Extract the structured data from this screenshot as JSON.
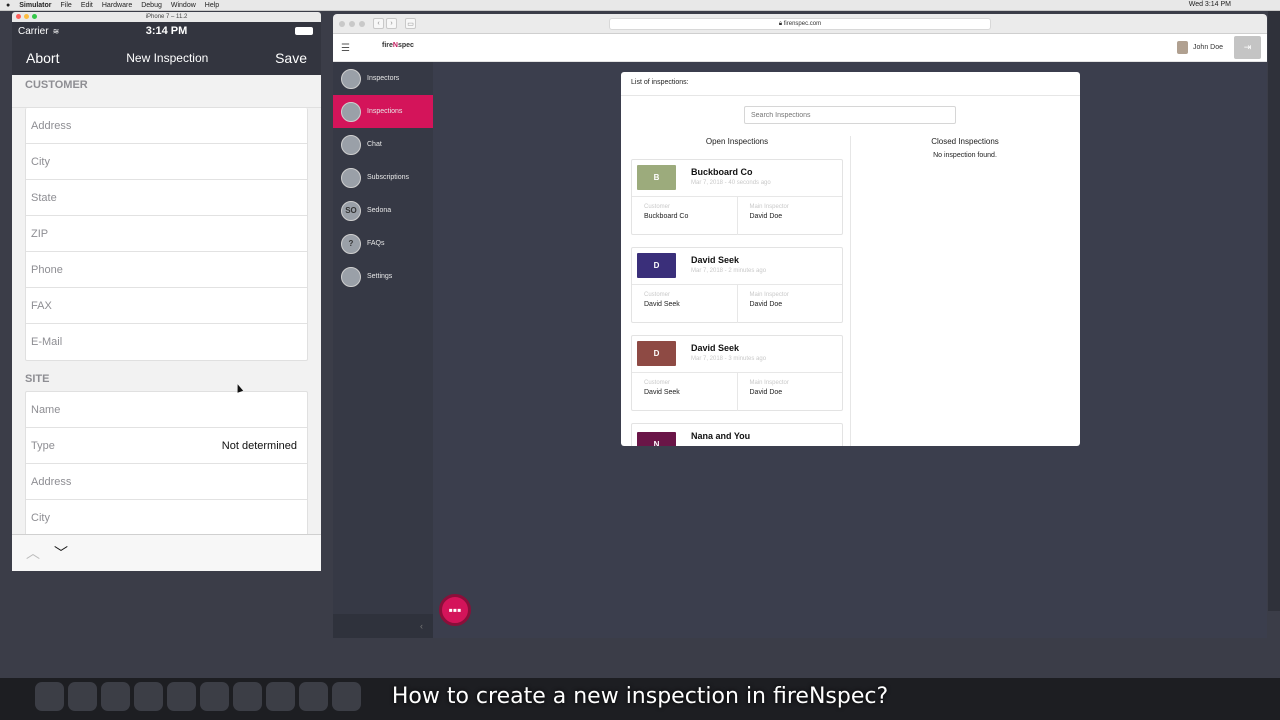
{
  "menubar": {
    "items": [
      "Simulator",
      "File",
      "Edit",
      "Hardware",
      "Debug",
      "Window",
      "Help"
    ],
    "clock": "Wed 3:14 PM"
  },
  "simulator": {
    "window_title": "iPhone 7 – 11.2",
    "status": {
      "carrier": "Carrier",
      "time": "3:14 PM"
    },
    "nav": {
      "left": "Abort",
      "title": "New Inspection",
      "right": "Save"
    },
    "customer_header": "CUSTOMER",
    "customer_fields": [
      "Address",
      "City",
      "State",
      "ZIP",
      "Phone",
      "FAX",
      "E-Mail"
    ],
    "site_header": "SITE",
    "site_fields": [
      {
        "label": "Name",
        "value": ""
      },
      {
        "label": "Type",
        "value": "Not determined"
      },
      {
        "label": "Address",
        "value": ""
      },
      {
        "label": "City",
        "value": ""
      }
    ],
    "toolbar": {
      "up": "︿",
      "down": "﹀"
    }
  },
  "browser": {
    "url": "firenspec.com",
    "app": {
      "logo": {
        "a": "fire",
        "b": "N",
        "c": "spec"
      },
      "user_name": "John Doe",
      "sidebar": [
        {
          "label": "Inspectors",
          "icon": "inspectors-icon",
          "glyph": ""
        },
        {
          "label": "Inspections",
          "icon": "inspections-icon",
          "glyph": "",
          "active": true
        },
        {
          "label": "Chat",
          "icon": "chat-icon",
          "glyph": ""
        },
        {
          "label": "Subscriptions",
          "icon": "subscriptions-icon",
          "glyph": ""
        },
        {
          "label": "Sedona",
          "icon": "sedona-icon",
          "glyph": "SO"
        },
        {
          "label": "FAQs",
          "icon": "faq-icon",
          "glyph": "?"
        },
        {
          "label": "Settings",
          "icon": "settings-icon",
          "glyph": ""
        }
      ],
      "panel": {
        "title": "List of inspections:",
        "search_placeholder": "Search Inspections",
        "open_header": "Open Inspections",
        "closed_header": "Closed Inspections",
        "closed_empty": "No inspection found.",
        "labels": {
          "customer": "Customer",
          "inspector": "Main Inspector"
        },
        "inspections": [
          {
            "initial": "B",
            "color": "#9cab7c",
            "name": "Buckboard Co",
            "date": "Mar 7, 2018 - 40 seconds ago",
            "customer": "Buckboard Co",
            "inspector": "David Doe"
          },
          {
            "initial": "D",
            "color": "#3a2f7a",
            "name": "David Seek",
            "date": "Mar 7, 2018 - 2 minutes ago",
            "customer": "David Seek",
            "inspector": "David Doe"
          },
          {
            "initial": "D",
            "color": "#8e4a44",
            "name": "David Seek",
            "date": "Mar 7, 2018 - 3 minutes ago",
            "customer": "David Seek",
            "inspector": "David Doe"
          },
          {
            "initial": "N",
            "color": "#6a1547",
            "name": "Nana and You",
            "date": "",
            "customer": "",
            "inspector": ""
          }
        ]
      }
    }
  },
  "caption": "How to create a new inspection in fireNspec?"
}
